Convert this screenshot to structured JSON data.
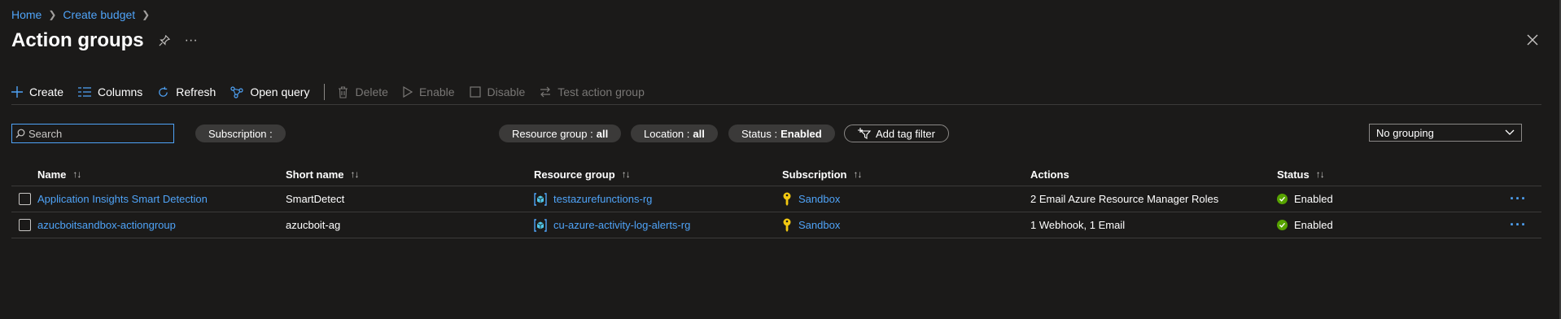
{
  "breadcrumb": {
    "items": [
      "Home",
      "Create budget"
    ]
  },
  "page": {
    "title": "Action groups"
  },
  "toolbar": {
    "create": "Create",
    "columns": "Columns",
    "refresh": "Refresh",
    "open_query": "Open query",
    "delete": "Delete",
    "enable": "Enable",
    "disable": "Disable",
    "test": "Test action group"
  },
  "filters": {
    "search_placeholder": "Search",
    "subscription_label": "Subscription :",
    "resource_group_label": "Resource group :",
    "resource_group_value": "all",
    "location_label": "Location :",
    "location_value": "all",
    "status_label": "Status :",
    "status_value": "Enabled",
    "add_tag_filter": "Add tag filter",
    "grouping_value": "No grouping"
  },
  "table": {
    "headers": [
      "Name",
      "Short name",
      "Resource group",
      "Subscription",
      "Actions",
      "Status"
    ],
    "sort_icon": "↑↓",
    "rows": [
      {
        "name": "Application Insights Smart Detection",
        "short_name": "SmartDetect",
        "resource_group": "testazurefunctions-rg",
        "subscription": "Sandbox",
        "actions": "2 Email Azure Resource Manager Roles",
        "status": "Enabled"
      },
      {
        "name": "azucboitsandbox-actiongroup",
        "short_name": "azucboit-ag",
        "resource_group": "cu-azure-activity-log-alerts-rg",
        "subscription": "Sandbox",
        "actions": "1 Webhook, 1 Email",
        "status": "Enabled"
      }
    ],
    "more_label": "···"
  },
  "colors": {
    "accent": "#4fa3f7",
    "background": "#1b1a19",
    "status_ok": "#57a300",
    "key": "#f2c811"
  }
}
